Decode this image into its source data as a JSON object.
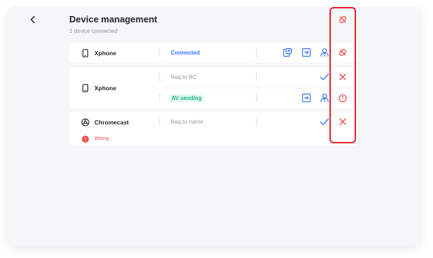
{
  "header": {
    "title": "Device management",
    "subtitle": "1 device connected"
  },
  "devices": [
    {
      "name": "Xphone",
      "status": "Connected"
    },
    {
      "name": "Xphone",
      "rows": [
        {
          "status": "Req to RC"
        },
        {
          "status": "AV sending"
        }
      ]
    },
    {
      "name": "Chromecast",
      "status": "Req to mirror",
      "warning": "Wrong"
    }
  ],
  "icons": {
    "back": "chevron-left-icon",
    "phone": "phone-icon",
    "chromecast": "chromecast-icon",
    "share_screen": "share-screen-icon",
    "transfer": "transfer-icon",
    "user": "user-icon",
    "disconnect": "disconnect-icon",
    "accept": "check-icon",
    "reject": "close-icon",
    "power": "power-icon",
    "warning": "warning-icon"
  },
  "colors": {
    "accent": "#3370ff",
    "danger": "#f54a45",
    "success": "#14b883",
    "highlight": "#e0202a"
  }
}
